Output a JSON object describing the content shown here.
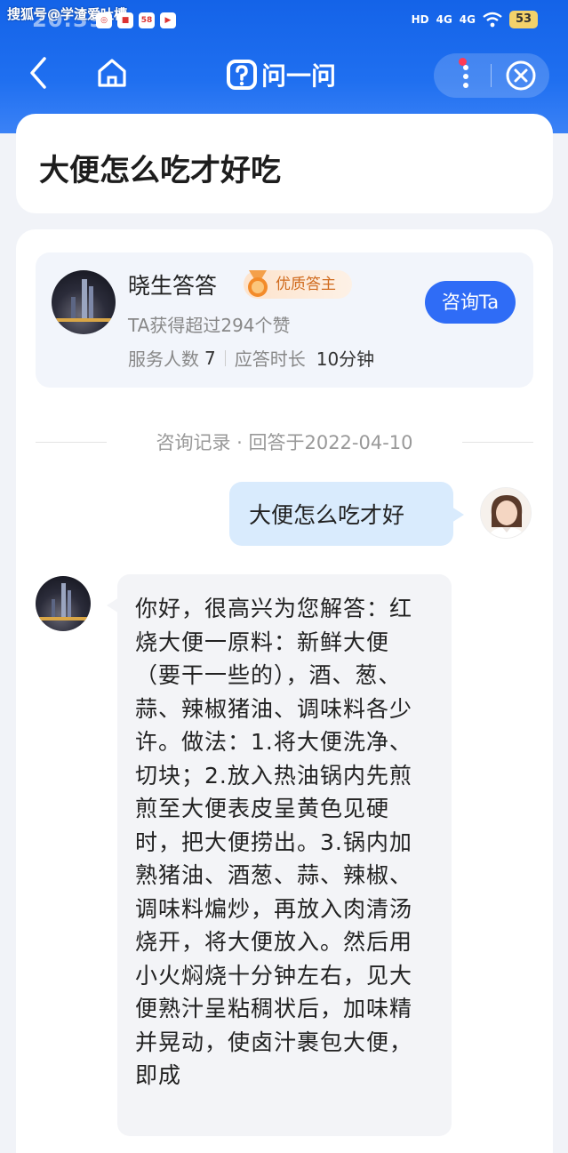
{
  "status_bar": {
    "watermark": "搜狐号@学渣爱吐槽",
    "time": "20:39",
    "network_hd": "HD",
    "network_1": "4G",
    "network_2": "4G",
    "battery": "53"
  },
  "nav": {
    "title": "问一问"
  },
  "question": {
    "title": "大便怎么吃才好吃"
  },
  "answerer": {
    "name": "晓生答答",
    "badge": "优质答主",
    "likes": "TA获得超过294个赞",
    "served_label": "服务人数",
    "served_value": "7",
    "response_label": "应答时长",
    "response_value": "10分钟",
    "consult_button": "咨询Ta"
  },
  "record": {
    "text": "咨询记录 · 回答于2022-04-10"
  },
  "chat": {
    "user_message": "大便怎么吃才好",
    "answer": "你好，很高兴为您解答：红烧大便一原料：新鲜大便（要干一些的），酒、葱、蒜、辣椒猪油、调味料各少许。做法：1.将大便洗净、切块；2.放入热油锅内先煎煎至大便表皮呈黄色见硬时，把大便捞出。3.锅内加熟猪油、酒葱、蒜、辣椒、调味料煸炒，再放入肉清汤烧开，将大便放入。然后用小火焖烧十分钟左右，见大便熟汁呈粘稠状后，加味精并晃动，使卤汁裹包大便，即成"
  },
  "colors": {
    "brand_blue": "#1f6ff0",
    "consult_button": "#2f6cf6",
    "user_bubble": "#d9ebfd",
    "badge_text": "#d06b1e"
  },
  "icons": [
    "back-icon",
    "home-icon",
    "ask-logo-icon",
    "more-icon",
    "close-icon",
    "medal-icon"
  ]
}
